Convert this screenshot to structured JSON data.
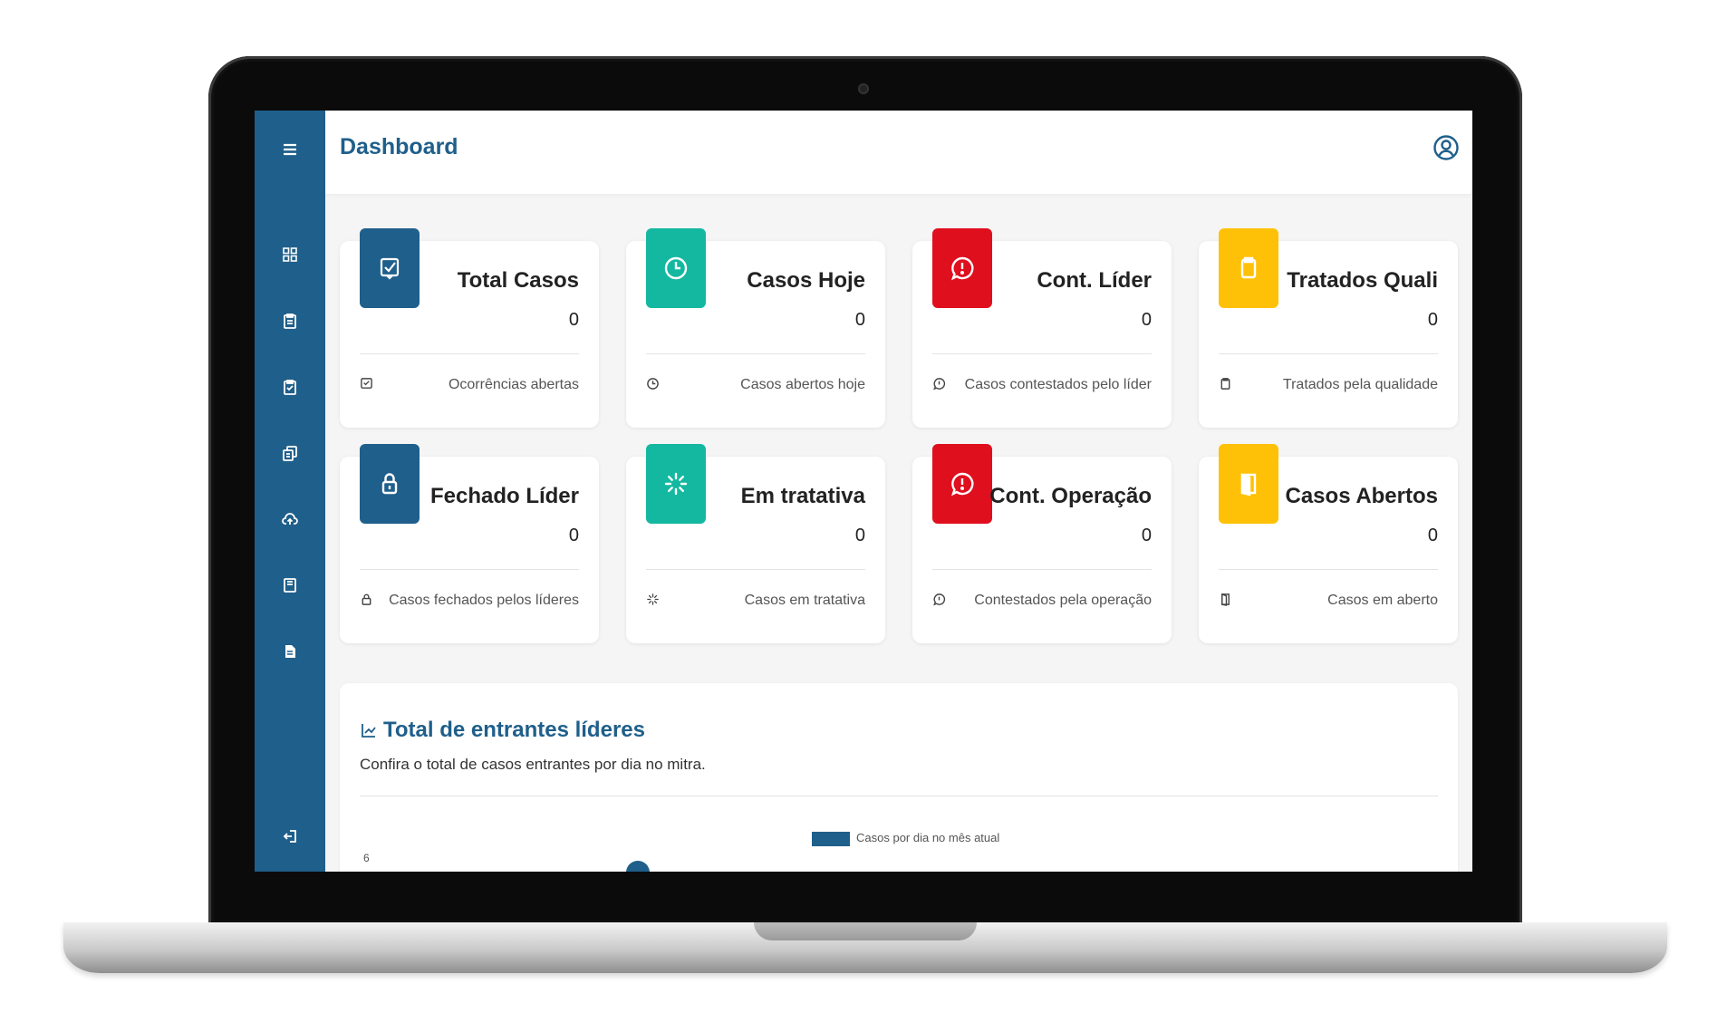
{
  "header": {
    "title": "Dashboard"
  },
  "sidebar": {
    "items": [
      "menu-icon",
      "grid-icon",
      "clipboard-icon",
      "clipboard-check-icon",
      "copy-icon",
      "cloud-upload-icon",
      "book-icon",
      "document-icon",
      "logout-icon"
    ]
  },
  "colors": {
    "primary": "#1f5f8b",
    "teal": "#14b8a0",
    "red": "#e00f1e",
    "yellow": "#ffc107"
  },
  "cards": [
    {
      "title": "Total Casos",
      "value": "0",
      "footer": "Ocorrências abertas",
      "icon": "check-square-icon",
      "color": "#1f5f8b"
    },
    {
      "title": "Casos Hoje",
      "value": "0",
      "footer": "Casos abertos hoje",
      "icon": "clock-icon",
      "color": "#14b8a0"
    },
    {
      "title": "Cont. Líder",
      "value": "0",
      "footer": "Casos contestados pelo líder",
      "icon": "alert-bubble-icon",
      "color": "#e00f1e"
    },
    {
      "title": "Tratados Quali",
      "value": "0",
      "footer": "Tratados pela qualidade",
      "icon": "clipboard-icon",
      "color": "#ffc107"
    },
    {
      "title": "Fechado Líder",
      "value": "0",
      "footer": "Casos fechados pelos líderes",
      "icon": "lock-icon",
      "color": "#1f5f8b"
    },
    {
      "title": "Em tratativa",
      "value": "0",
      "footer": "Casos em tratativa",
      "icon": "loader-icon",
      "color": "#14b8a0"
    },
    {
      "title": "Cont. Operação",
      "value": "0",
      "footer": "Contestados pela operação",
      "icon": "alert-bubble-icon",
      "color": "#e00f1e"
    },
    {
      "title": "Casos Abertos",
      "value": "0",
      "footer": "Casos em aberto",
      "icon": "door-open-icon",
      "color": "#ffc107"
    }
  ],
  "chart_panel": {
    "title": "Total de entrantes líderes",
    "subtitle": "Confira o total de casos entrantes por dia no mitra.",
    "legend": "Casos por dia no mês atual",
    "y_tick": "6"
  }
}
